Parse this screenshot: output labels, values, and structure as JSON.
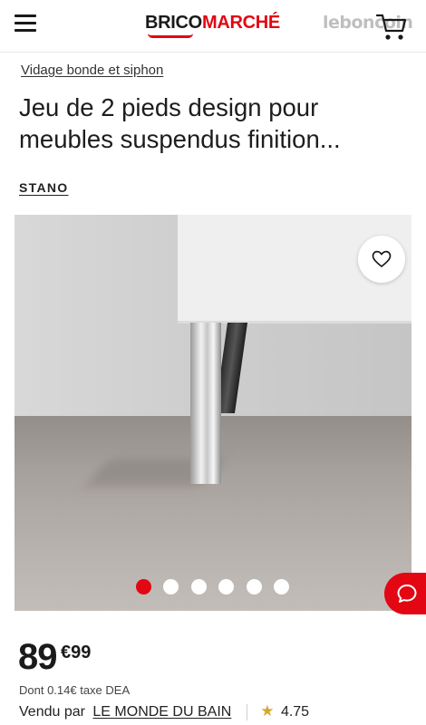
{
  "header": {
    "logo_part1": "BRICO",
    "logo_part2": "MARCHÉ",
    "watermark": "leboncoin",
    "brand_color": "#e30613"
  },
  "breadcrumb": "Vidage bonde et siphon",
  "product": {
    "title": "Jeu de 2 pieds design pour meubles suspendus finition...",
    "brand": "STANO",
    "gallery_total_images": 6,
    "gallery_active_index": 0
  },
  "price": {
    "integer": "89",
    "currency_decimals": "€99",
    "tax_note": "Dont 0.14€ taxe DEA"
  },
  "seller": {
    "prefix": "Vendu par",
    "name": "LE MONDE DU BAIN",
    "rating": "4.75"
  },
  "icons": {
    "menu": "menu-icon",
    "cart": "cart-icon",
    "favorite": "heart-icon",
    "chat": "chat-icon",
    "star": "star-icon"
  }
}
